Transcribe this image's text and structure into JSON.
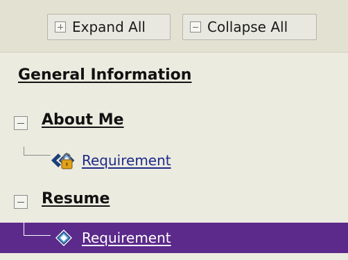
{
  "toolbar": {
    "expand_label": "Expand All",
    "collapse_label": "Collapse All"
  },
  "tree": {
    "section_title": "General Information",
    "groups": [
      {
        "label": "About Me",
        "children": [
          {
            "label": "Requirement",
            "icon": "locked-requirement-icon",
            "selected": false
          }
        ]
      },
      {
        "label": "Resume",
        "children": [
          {
            "label": "Requirement",
            "icon": "requirement-icon",
            "selected": true
          }
        ]
      }
    ]
  },
  "colors": {
    "selection": "#5b2a8a",
    "link": "#1d2a88",
    "background": "#ecebe0",
    "toolbar": "#e3e2d2"
  }
}
